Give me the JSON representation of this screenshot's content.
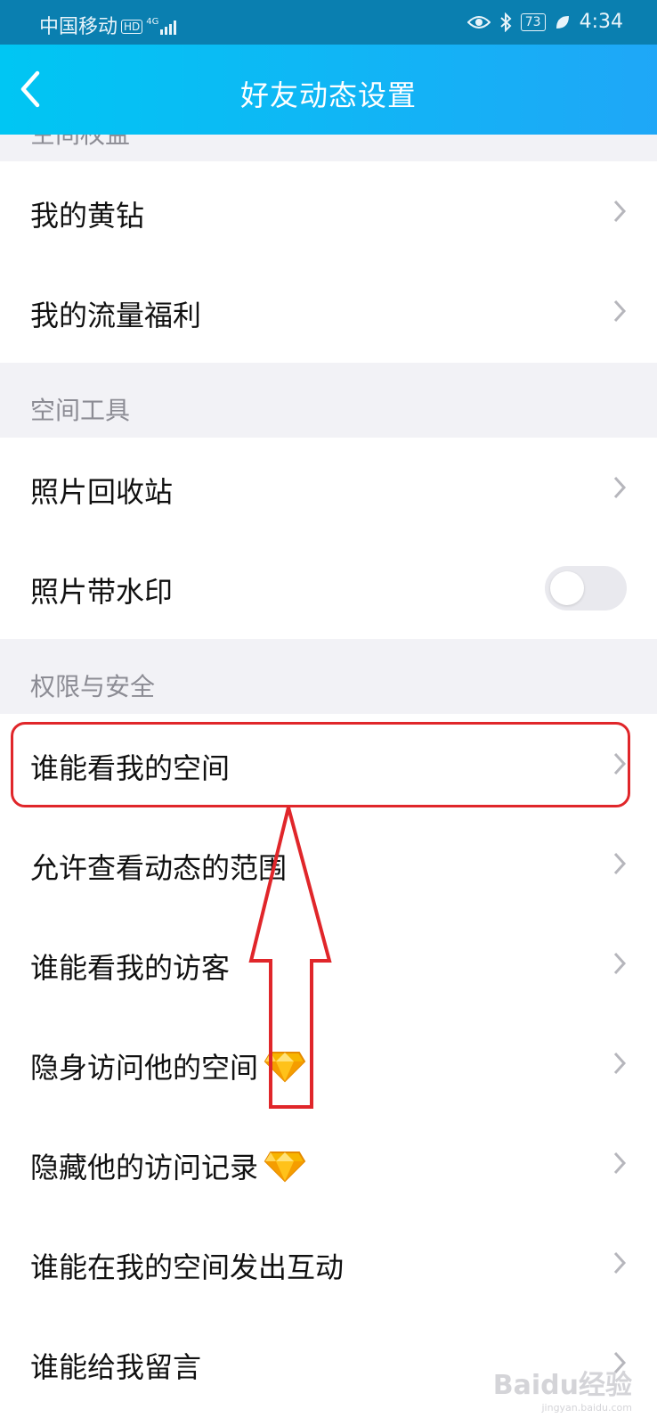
{
  "status_bar": {
    "carrier": "中国移动",
    "hd": "HD",
    "network": "4G",
    "battery": "73",
    "time": "4:34"
  },
  "nav": {
    "title": "好友动态设置"
  },
  "sections": {
    "space_rights": {
      "header": "空间权益",
      "items": [
        {
          "label": "我的黄钻"
        },
        {
          "label": "我的流量福利"
        }
      ]
    },
    "space_tools": {
      "header": "空间工具",
      "items": [
        {
          "label": "照片回收站"
        },
        {
          "label": "照片带水印",
          "toggle": false
        }
      ]
    },
    "privacy": {
      "header": "权限与安全",
      "items": [
        {
          "label": "谁能看我的空间"
        },
        {
          "label": "允许查看动态的范围"
        },
        {
          "label": "谁能看我的访客"
        },
        {
          "label": "隐身访问他的空间",
          "badge": "diamond-icon"
        },
        {
          "label": "隐藏他的访问记录",
          "badge": "diamond-icon"
        },
        {
          "label": "谁能在我的空间发出互动"
        },
        {
          "label": "谁能给我留言"
        }
      ]
    }
  },
  "watermark": {
    "brand": "Baidu经验",
    "url": "jingyan.baidu.com"
  },
  "colors": {
    "nav_gradient_start": "#00c6f3",
    "nav_gradient_end": "#1fa7f7",
    "highlight": "#e0262a",
    "background": "#f2f2f6"
  }
}
